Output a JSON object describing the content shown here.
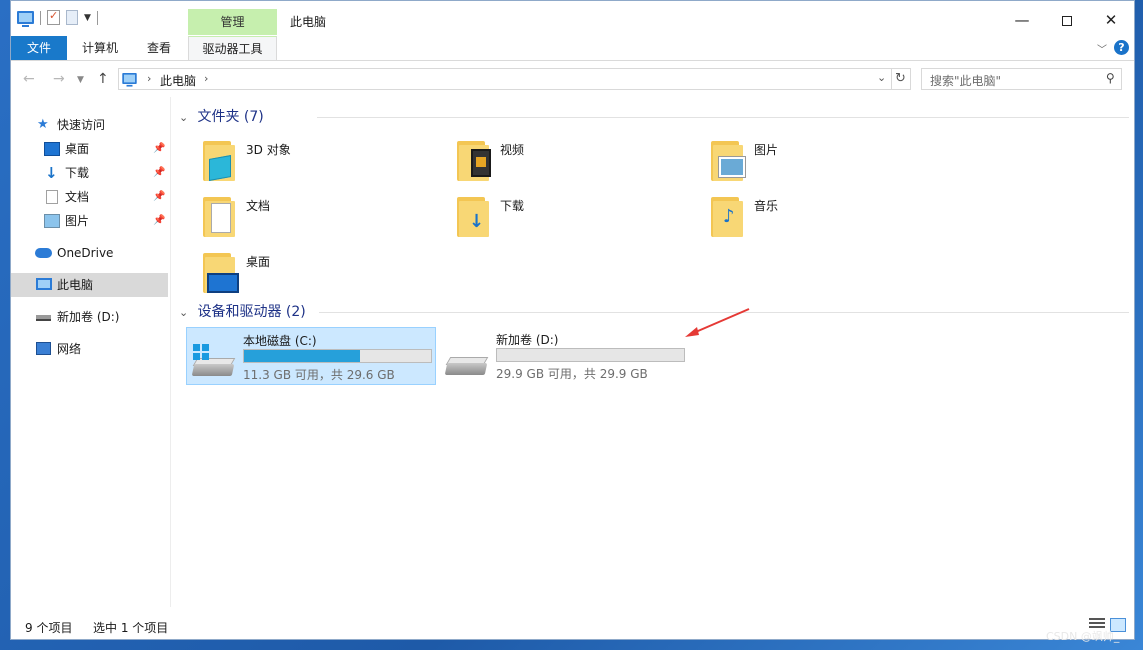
{
  "window": {
    "title": "此电脑",
    "context_tab": "管理",
    "quick_access_toolbar": [
      "computer-icon",
      "properties-icon",
      "new-folder-icon",
      "customize-dropdown"
    ]
  },
  "ribbon": {
    "tabs": [
      "文件",
      "计算机",
      "查看",
      "驱动器工具"
    ],
    "active_context_tab": "驱动器工具"
  },
  "address": {
    "location": "此电脑",
    "search_placeholder": "搜索\"此电脑\""
  },
  "sidebar": {
    "items": [
      {
        "label": "快速访问",
        "icon": "star-icon"
      },
      {
        "label": "桌面",
        "icon": "desktop-icon",
        "pinned": true
      },
      {
        "label": "下载",
        "icon": "download-icon",
        "pinned": true
      },
      {
        "label": "文档",
        "icon": "document-icon",
        "pinned": true
      },
      {
        "label": "图片",
        "icon": "picture-icon",
        "pinned": true
      },
      {
        "label": "OneDrive",
        "icon": "cloud-icon"
      },
      {
        "label": "此电脑",
        "icon": "this-pc-icon",
        "selected": true
      },
      {
        "label": "新加卷 (D:)",
        "icon": "drive-icon"
      },
      {
        "label": "网络",
        "icon": "network-icon"
      }
    ]
  },
  "content": {
    "folders_header": "文件夹 (7)",
    "folders": [
      {
        "label": "3D 对象",
        "icon": "3d-objects-icon"
      },
      {
        "label": "视频",
        "icon": "videos-icon"
      },
      {
        "label": "图片",
        "icon": "pictures-icon"
      },
      {
        "label": "文档",
        "icon": "documents-icon"
      },
      {
        "label": "下载",
        "icon": "downloads-icon"
      },
      {
        "label": "音乐",
        "icon": "music-icon"
      },
      {
        "label": "桌面",
        "icon": "desktop-icon"
      }
    ],
    "devices_header": "设备和驱动器 (2)",
    "drives": [
      {
        "name": "本地磁盘 (C:)",
        "info": "11.3 GB 可用，共 29.6 GB",
        "used_fraction": 0.62,
        "selected": true,
        "icon": "windows-drive-icon"
      },
      {
        "name": "新加卷 (D:)",
        "info": "29.9 GB 可用，共 29.9 GB",
        "used_fraction": 0.0,
        "selected": false,
        "icon": "drive-icon"
      }
    ]
  },
  "status": {
    "item_count": "9 个项目",
    "selection": "选中 1 个项目"
  },
  "watermark": "CSDN @飒帅_",
  "colors": {
    "accent": "#1979ca",
    "manage_tab": "#c6efae",
    "selection": "#cce8ff",
    "drive_bar_fill": "#26a0da",
    "header_text": "#1e3287",
    "annotation_arrow": "#e53935"
  }
}
